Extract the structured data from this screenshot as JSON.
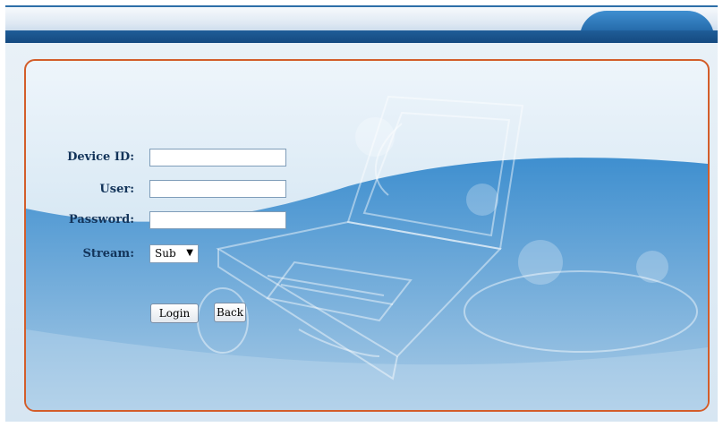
{
  "form": {
    "device_id": {
      "label": "Device ID:",
      "value": ""
    },
    "user": {
      "label": "User:",
      "value": ""
    },
    "password": {
      "label": "Password:",
      "value": ""
    },
    "stream": {
      "label": "Stream:",
      "selected": "Sub"
    }
  },
  "buttons": {
    "login": "Login",
    "back": "Back"
  },
  "colors": {
    "frame_border": "#d35d2a",
    "header_blue": "#1f5d98"
  }
}
